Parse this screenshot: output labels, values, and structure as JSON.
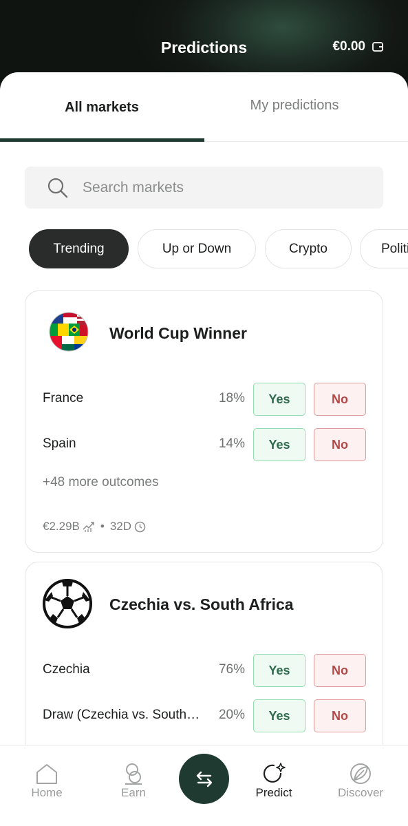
{
  "header": {
    "title": "Predictions",
    "balance": "€0.00"
  },
  "tabs": [
    {
      "label": "All markets",
      "active": true
    },
    {
      "label": "My predictions",
      "active": false
    }
  ],
  "search": {
    "placeholder": "Search markets"
  },
  "filters": [
    {
      "label": "Trending",
      "active": true
    },
    {
      "label": "Up or Down",
      "active": false
    },
    {
      "label": "Crypto",
      "active": false
    },
    {
      "label": "Politics",
      "active": false
    }
  ],
  "markets": [
    {
      "title": "World Cup Winner",
      "icon": "world-flags-ball-icon",
      "outcomes": [
        {
          "name": "France",
          "pct": "18%",
          "yes": "Yes",
          "no": "No"
        },
        {
          "name": "Spain",
          "pct": "14%",
          "yes": "Yes",
          "no": "No"
        }
      ],
      "more": "+48 more outcomes",
      "volume": "€2.29B",
      "separator": "•",
      "time_left": "32D"
    },
    {
      "title": "Czechia vs. South Africa",
      "icon": "soccer-ball-icon",
      "outcomes": [
        {
          "name": "Czechia",
          "pct": "76%",
          "yes": "Yes",
          "no": "No"
        },
        {
          "name": "Draw (Czechia vs. South Africa)",
          "pct": "20%",
          "yes": "Yes",
          "no": "No"
        }
      ]
    }
  ],
  "bottom_nav": [
    {
      "label": "Home",
      "icon": "home-icon",
      "active": false
    },
    {
      "label": "Earn",
      "icon": "earn-coins-icon",
      "active": false
    },
    {
      "label": "",
      "icon": "swap-arrows-icon",
      "active": false
    },
    {
      "label": "Predict",
      "icon": "predict-sparkle-icon",
      "active": true
    },
    {
      "label": "Discover",
      "icon": "discover-leaf-icon",
      "active": false
    }
  ],
  "colors": {
    "accent": "#1f3b31",
    "yes_text": "#2e6a4c",
    "yes_border": "#92ddb0",
    "no_text": "#b24848",
    "no_border": "#e29a9a",
    "chip_active_bg": "#2a2c2b"
  }
}
